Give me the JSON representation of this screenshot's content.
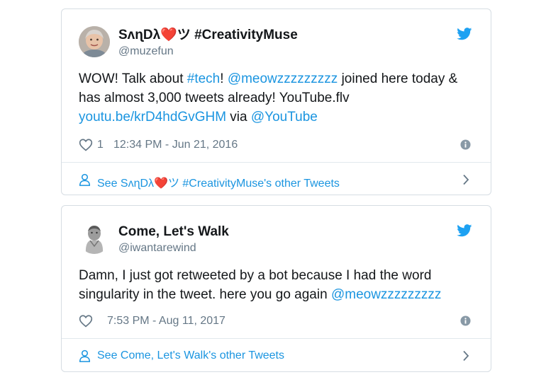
{
  "tweets": [
    {
      "display_name": "SᴧɳDλ❤️ツ #CreativityMuse",
      "handle": "@muzefun",
      "text_parts": [
        {
          "t": "WOW! Talk about "
        },
        {
          "t": "#tech",
          "link": true
        },
        {
          "t": "! "
        },
        {
          "t": "@meowzzzzzzzzz",
          "link": true
        },
        {
          "t": " joined here today & has almost 3,000 tweets already!  YouTube.flv "
        },
        {
          "t": "youtu.be/krD4hdGvGHM",
          "link": true
        },
        {
          "t": " via "
        },
        {
          "t": "@YouTube",
          "link": true
        }
      ],
      "like_count": "1",
      "timestamp": "12:34 PM - Jun 21, 2016",
      "footer": "See SᴧɳDλ❤️ツ #CreativityMuse's other Tweets"
    },
    {
      "display_name": "Come, Let's Walk",
      "handle": "@iwantarewind",
      "text_parts": [
        {
          "t": "Damn, I just got retweeted by a bot because I had the word singularity in the tweet.  here you go again "
        },
        {
          "t": "@meowzzzzzzzzz",
          "link": true
        }
      ],
      "like_count": "",
      "timestamp": "7:53 PM - Aug 11, 2017",
      "footer": "See Come, Let's Walk's other Tweets"
    }
  ],
  "icons": {
    "bird": "twitter-bird-icon",
    "heart": "heart-icon",
    "info": "info-icon",
    "person": "person-icon",
    "chevron": "chevron-right-icon"
  },
  "colors": {
    "link": "#1b95e0",
    "muted": "#657786",
    "bird": "#1da1f2",
    "border": "#d6dde3"
  }
}
